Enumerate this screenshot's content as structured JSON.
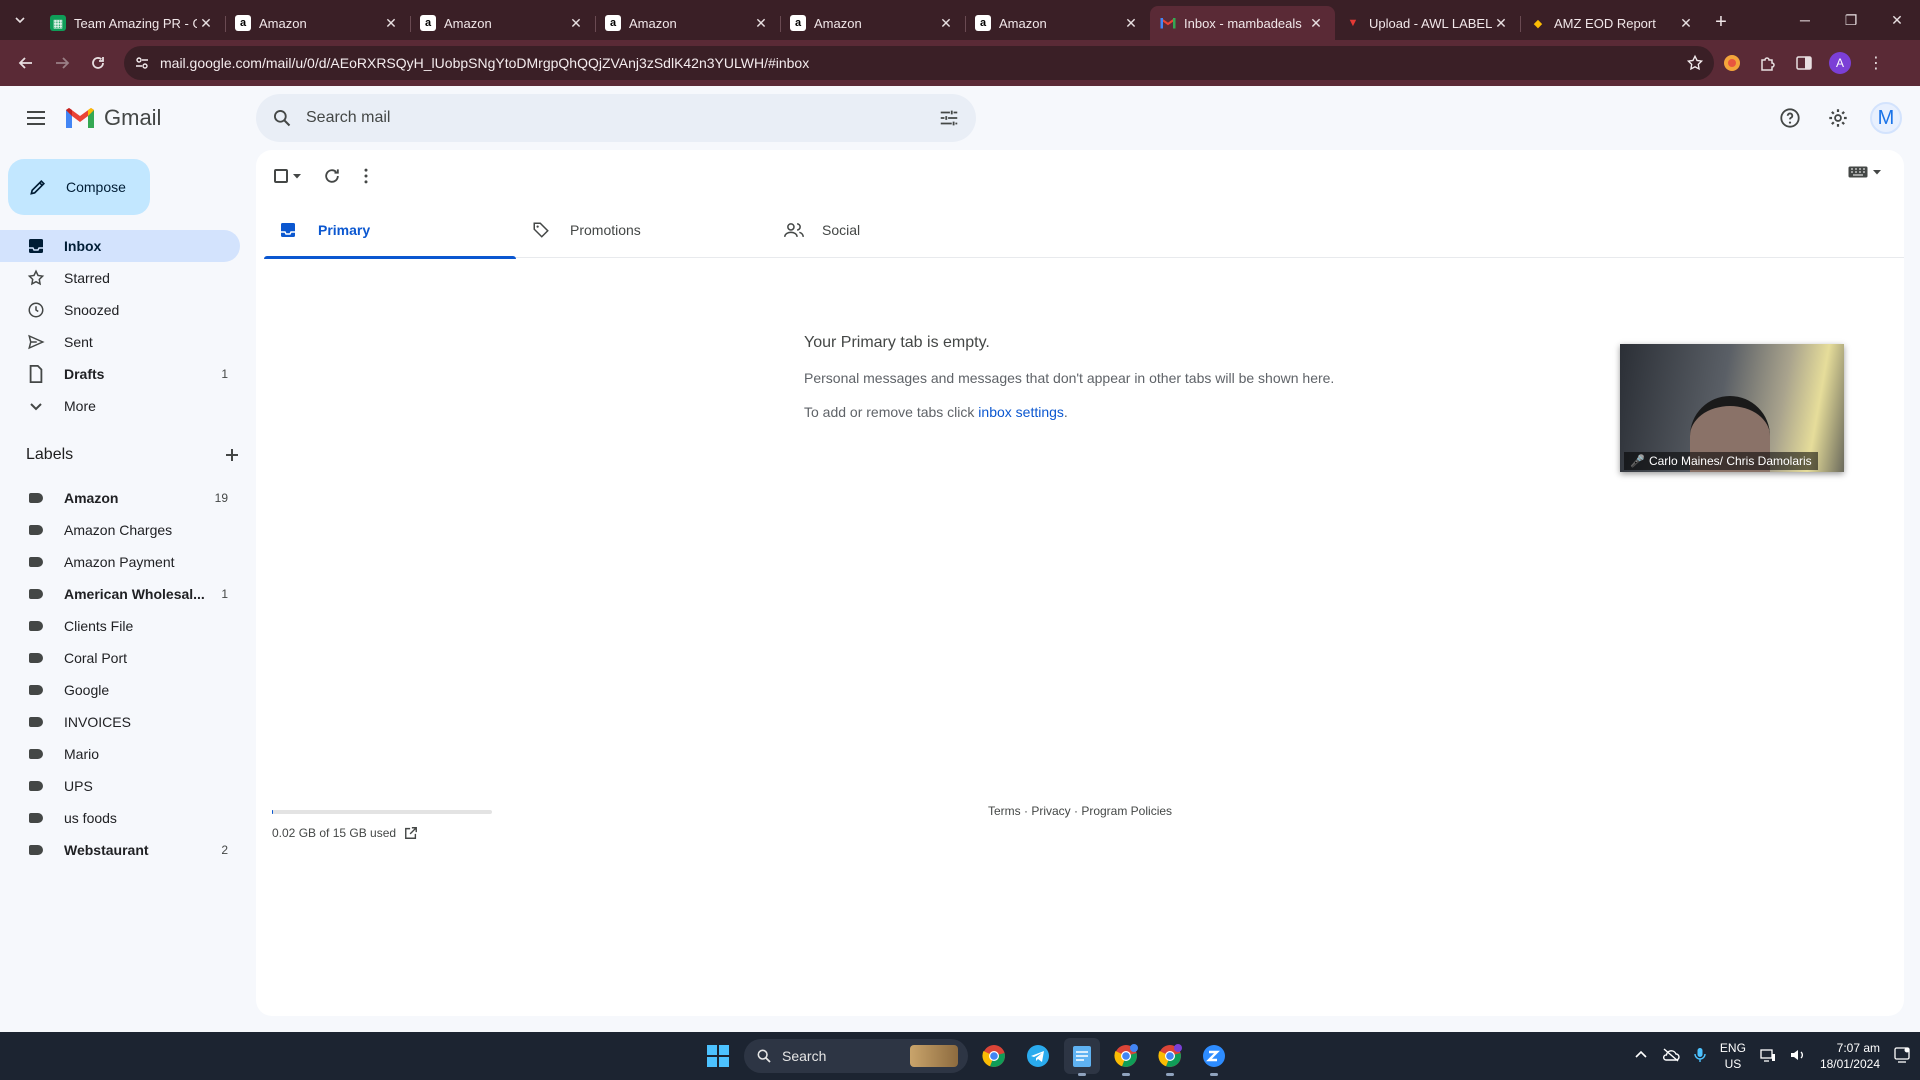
{
  "browser": {
    "tabs": [
      {
        "title": "Team Amazing PR - G",
        "icon": "sheets-icon"
      },
      {
        "title": "Amazon",
        "icon": "amazon-icon"
      },
      {
        "title": "Amazon",
        "icon": "amazon-icon"
      },
      {
        "title": "Amazon",
        "icon": "amazon-icon"
      },
      {
        "title": "Amazon",
        "icon": "amazon-icon"
      },
      {
        "title": "Amazon",
        "icon": "amazon-icon"
      },
      {
        "title": "Inbox - mambadeals",
        "icon": "gmail-icon",
        "active": true
      },
      {
        "title": "Upload - AWL LABEL",
        "icon": "awl-icon"
      },
      {
        "title": "AMZ EOD Report",
        "icon": "report-icon"
      }
    ],
    "url": "mail.google.com/mail/u/0/d/AEoRXRSQyH_lUobpSNgYtoDMrgpQhQQjZVAnj3zSdlK42n3YULWH/#inbox",
    "profile_initial": "A"
  },
  "gmail": {
    "logo_text": "Gmail",
    "search_placeholder": "Search mail",
    "avatar_initial": "M",
    "compose_label": "Compose",
    "nav": [
      {
        "label": "Inbox",
        "icon": "inbox-icon",
        "count": "",
        "active": true
      },
      {
        "label": "Starred",
        "icon": "star-icon",
        "count": ""
      },
      {
        "label": "Snoozed",
        "icon": "clock-icon",
        "count": ""
      },
      {
        "label": "Sent",
        "icon": "send-icon",
        "count": ""
      },
      {
        "label": "Drafts",
        "icon": "draft-icon",
        "count": "1",
        "bold": true
      },
      {
        "label": "More",
        "icon": "chevron-down-icon",
        "count": ""
      }
    ],
    "labels_title": "Labels",
    "labels": [
      {
        "label": "Amazon",
        "count": "19",
        "bold": true
      },
      {
        "label": "Amazon Charges",
        "count": ""
      },
      {
        "label": "Amazon Payment",
        "count": ""
      },
      {
        "label": "American Wholesal...",
        "count": "1",
        "bold": true
      },
      {
        "label": "Clients File",
        "count": ""
      },
      {
        "label": "Coral Port",
        "count": ""
      },
      {
        "label": "Google",
        "count": ""
      },
      {
        "label": "INVOICES",
        "count": ""
      },
      {
        "label": "Mario",
        "count": ""
      },
      {
        "label": "UPS",
        "count": ""
      },
      {
        "label": "us foods",
        "count": ""
      },
      {
        "label": "Webstaurant",
        "count": "2",
        "bold": true
      }
    ],
    "tabs": [
      {
        "label": "Primary",
        "icon": "inbox-icon",
        "active": true
      },
      {
        "label": "Promotions",
        "icon": "tag-icon"
      },
      {
        "label": "Social",
        "icon": "people-icon"
      }
    ],
    "empty": {
      "heading": "Your Primary tab is empty.",
      "line1": "Personal messages and messages that don't appear in other tabs will be shown here.",
      "line2_prefix": "To add or remove tabs click ",
      "line2_link": "inbox settings",
      "line2_suffix": "."
    },
    "storage": {
      "text": "0.02 GB of 15 GB used",
      "used_fraction": 0.0013
    },
    "footer": "Terms · Privacy · Program Policies"
  },
  "video_overlay": {
    "caption": "Carlo Maines/ Chris Damolaris"
  },
  "taskbar": {
    "search_label": "Search",
    "language": "ENG",
    "region": "US",
    "time": "7:07 am",
    "date": "18/01/2024"
  },
  "colors": {
    "chrome_dark": "#3a1f26",
    "chrome_mid": "#5a2a36",
    "gmail_active_blue": "#0b57d0",
    "compose_bg": "#c2e7ff",
    "nav_active_bg": "#d3e3fd",
    "taskbar_bg": "#1c2431"
  }
}
